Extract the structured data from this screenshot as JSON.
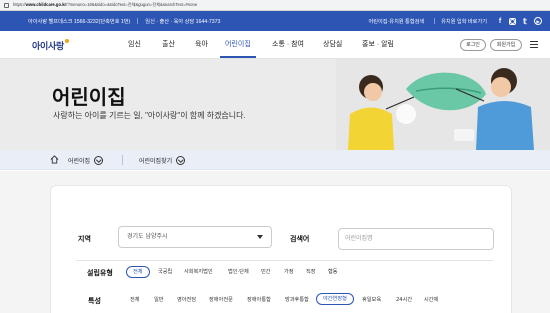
{
  "browser": {
    "url_prefix": "https://",
    "url_host": "www.childcare.go.kr",
    "url_path": "/?menuno=166&sido=&sidoText=전체&gugun=전체&searchText=#none"
  },
  "topbar": {
    "helpdesk": "아이사랑 헬프데스크 1566-3232(단축번호 1번)",
    "counsel": "임신 · 출산 · 육아 상담 1644-7373",
    "links": [
      "어린이집·유치원 통합검색",
      "유치원 입학 바로가기"
    ],
    "sns": [
      "facebook-icon",
      "instagram-icon",
      "twitter-icon",
      "youtube-icon"
    ]
  },
  "nav": {
    "logo": "아이사랑",
    "menu": [
      "임신",
      "출산",
      "육아",
      "어린이집",
      "소통 · 참여",
      "상담실",
      "홍보 · 알림"
    ],
    "active": "어린이집",
    "login": "로그인",
    "signup": "회원가입"
  },
  "hero": {
    "title": "어린이집",
    "subtitle": "사랑하는 아이를 기르는 일, \"아이사랑\"이 함께 하겠습니다."
  },
  "breadcrumb": {
    "level1": "어린이집",
    "level2": "어린이집찾기"
  },
  "search": {
    "region_label": "지역",
    "region_value": "경기도 남양주시",
    "keyword_label": "검색어",
    "keyword_placeholder": "어린이집명",
    "type_label": "설립유형",
    "types": [
      "전체",
      "국공립",
      "사회복지법인",
      "법인·단체",
      "민간",
      "가정",
      "직장",
      "협동"
    ],
    "type_selected": "전체",
    "feature_label": "특성",
    "features": [
      "전체",
      "일반",
      "영아전담",
      "장애아전문",
      "장애아통합",
      "방과후통합",
      "야간연장형",
      "휴일보육",
      "24시간",
      "시간제"
    ],
    "feature_selected": "야간연장형"
  },
  "colors": {
    "brand_blue": "#2d55b4",
    "hero_bg": "#ebebeb",
    "crumb_bg": "#e9eef7"
  }
}
